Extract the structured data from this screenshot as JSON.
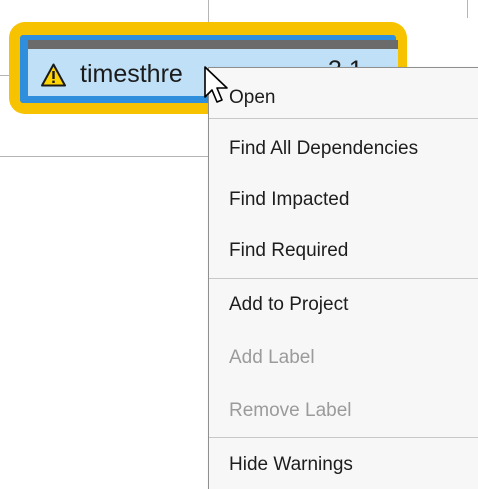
{
  "node": {
    "label": "timesthre",
    "label_tail": "3 1",
    "icon": "warning-icon"
  },
  "context_menu": {
    "groups": [
      [
        {
          "label": "Open",
          "enabled": true
        }
      ],
      [
        {
          "label": "Find All Dependencies",
          "enabled": true
        },
        {
          "label": "Find Impacted",
          "enabled": true
        },
        {
          "label": "Find Required",
          "enabled": true
        }
      ],
      [
        {
          "label": "Add to Project",
          "enabled": true
        },
        {
          "label": "Add Label",
          "enabled": false
        },
        {
          "label": "Remove Label",
          "enabled": false
        }
      ],
      [
        {
          "label": "Hide Warnings",
          "enabled": true
        }
      ]
    ]
  },
  "colors": {
    "highlight": "#f7c300",
    "selection": "#2f8fdc",
    "node_fill": "#bfe0f7",
    "node_header": "#6b6b6b",
    "menu_bg": "#f7f7f7",
    "disabled_text": "#9b9b9b"
  }
}
